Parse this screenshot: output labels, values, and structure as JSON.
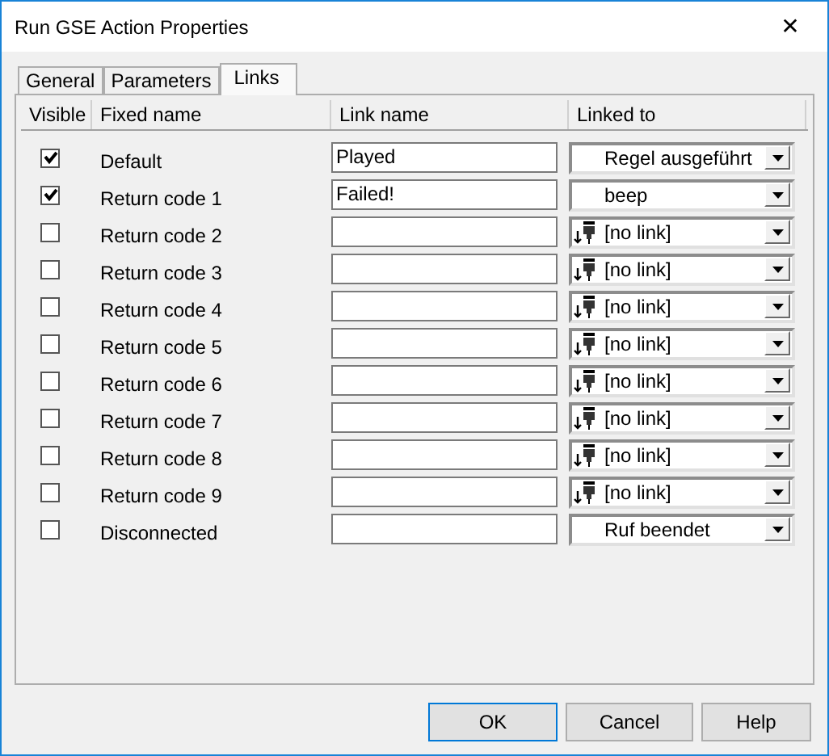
{
  "window": {
    "title": "Run GSE Action Properties",
    "close": "✕"
  },
  "tabs": [
    {
      "label": "General",
      "selected": false
    },
    {
      "label": "Parameters",
      "selected": false
    },
    {
      "label": "Links",
      "selected": true
    }
  ],
  "table": {
    "columns": [
      "Visible",
      "Fixed name",
      "Link name",
      "Linked to"
    ],
    "rows": [
      {
        "checked": true,
        "fixed_name": "Default",
        "link_name": "Played",
        "linked_to": {
          "kind": "target",
          "text": "Regel ausgeführt"
        }
      },
      {
        "checked": true,
        "fixed_name": "Return code 1",
        "link_name": "Failed!",
        "linked_to": {
          "kind": "target",
          "text": "beep"
        }
      },
      {
        "checked": false,
        "fixed_name": "Return code 2",
        "linked_to": {
          "kind": "none",
          "text": "[no link]"
        }
      },
      {
        "checked": false,
        "fixed_name": "Return code 3",
        "linked_to": {
          "kind": "none",
          "text": "[no link]"
        }
      },
      {
        "checked": false,
        "fixed_name": "Return code 4",
        "linked_to": {
          "kind": "none",
          "text": "[no link]"
        }
      },
      {
        "checked": false,
        "fixed_name": "Return code 5",
        "linked_to": {
          "kind": "none",
          "text": "[no link]"
        }
      },
      {
        "checked": false,
        "fixed_name": "Return code 6",
        "linked_to": {
          "kind": "none",
          "text": "[no link]"
        }
      },
      {
        "checked": false,
        "fixed_name": "Return code 7",
        "linked_to": {
          "kind": "none",
          "text": "[no link]"
        }
      },
      {
        "checked": false,
        "fixed_name": "Return code 8",
        "linked_to": {
          "kind": "none",
          "text": "[no link]"
        }
      },
      {
        "checked": false,
        "fixed_name": "Return code 9",
        "linked_to": {
          "kind": "none",
          "text": "[no link]"
        }
      },
      {
        "checked": false,
        "fixed_name": "Disconnected",
        "linked_to": {
          "kind": "target",
          "text": "Ruf beendet"
        }
      }
    ]
  },
  "buttons": [
    "OK",
    "Cancel",
    "Help"
  ]
}
